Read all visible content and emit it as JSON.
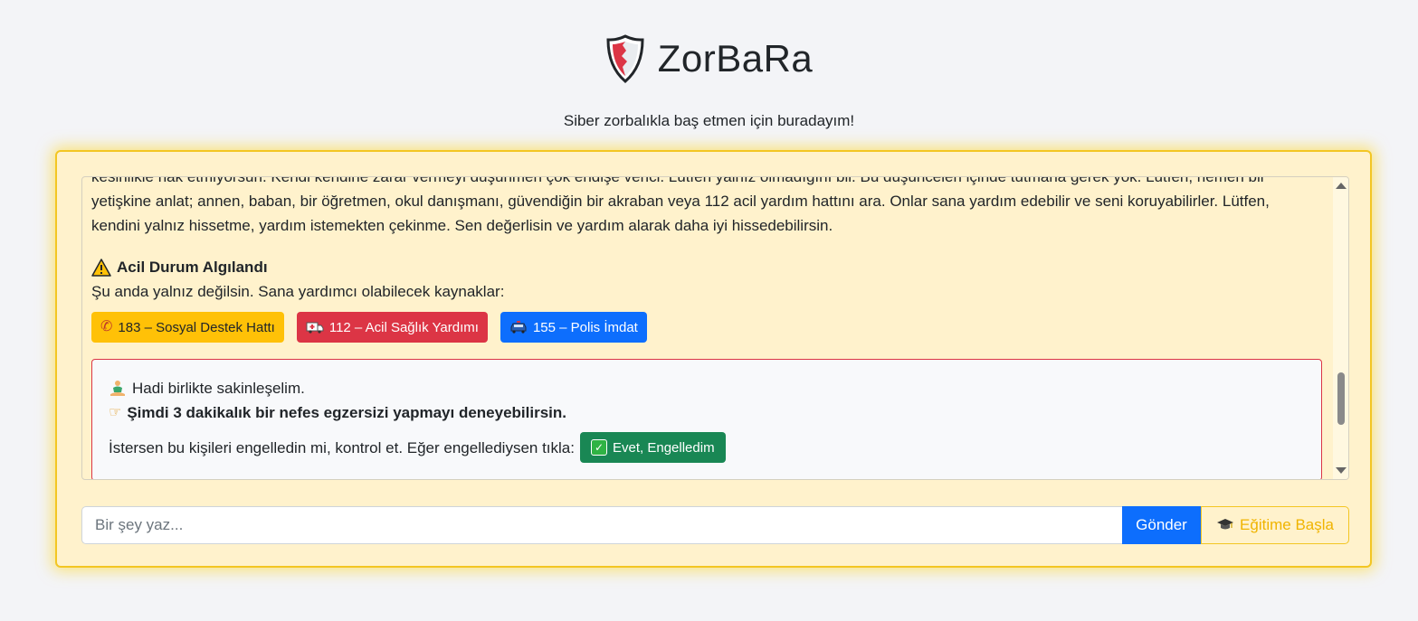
{
  "header": {
    "title": "ZorBaRa",
    "subtitle": "Siber zorbalıkla baş etmen için buradayım!",
    "logo_icon": "shield-icon"
  },
  "chat": {
    "message_cut_line": "kesinlikle hak etmiyorsun. Kendi kendine zarar vermeyi düşünmen çok endişe verici. Lütfen yalnız olmadığını bil. Bu düşünceleri içinde tutmana gerek yok. Lütfen, hemen bir",
    "message_line_2": "yetişkine anlat; annen, baban, bir öğretmen, okul danışmanı, güvendiğin bir akraban veya 112 acil yardım hattını ara. Onlar sana yardım edebilir ve seni koruyabilirler. Lütfen,",
    "message_line_3": "kendini yalnız hissetme, yardım istemekten çekinme. Sen değerlisin ve yardım alarak daha iyi hissedebilirsin.",
    "emergency_title": "Acil Durum Algılandı",
    "emergency_icon": "warning-icon",
    "resources_intro": "Şu anda yalnız değilsin. Sana yardımcı olabilecek kaynaklar:",
    "hotlines": [
      {
        "label": "183 – Sosyal Destek Hattı",
        "icon": "phone-icon",
        "color": "#ffc107"
      },
      {
        "label": "112 – Acil Sağlık Yardımı",
        "icon": "ambulance-icon",
        "color": "#dc3545"
      },
      {
        "label": "155 – Polis İmdat",
        "icon": "police-car-icon",
        "color": "#0d6efd"
      }
    ],
    "calm": {
      "line1": "Hadi birlikte sakinleşelim.",
      "line1_icon": "meditation-icon",
      "line2": "Şimdi 3 dakikalık bir nefes egzersizi yapmayı deneyebilirsin.",
      "line2_icon": "pointing-hand-icon",
      "block_prompt": "İstersen bu kişileri engelledin mi, kontrol et. Eğer engellediysen tıkla:",
      "confirm_label": "Evet, Engelledim",
      "confirm_icon": "check-icon"
    }
  },
  "composer": {
    "placeholder": "Bir şey yaz...",
    "value": "",
    "send_label": "Gönder",
    "training_label": "Eğitime Başla",
    "training_icon": "graduation-cap-icon"
  },
  "colors": {
    "accent": "#0d6efd",
    "panel_bg": "#fff2cc",
    "panel_border": "#f3c623",
    "danger": "#dc3545",
    "success": "#198754"
  }
}
